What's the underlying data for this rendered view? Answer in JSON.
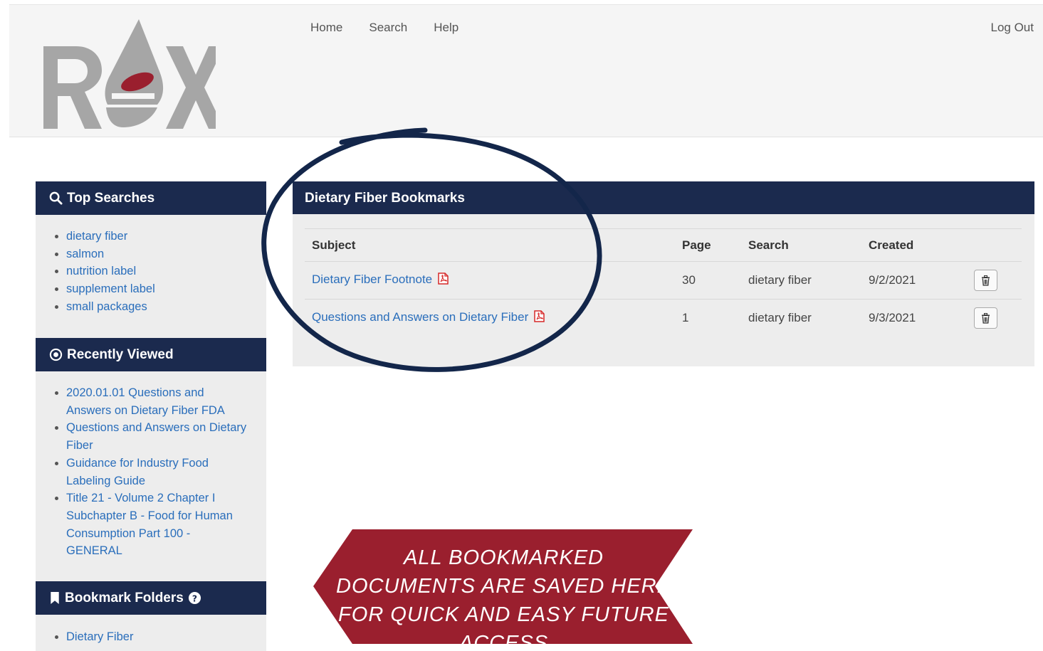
{
  "header": {
    "logo_text": "REX",
    "nav": [
      "Home",
      "Search",
      "Help"
    ],
    "logout": "Log Out"
  },
  "sidebar": {
    "top_searches": {
      "title": "Top Searches",
      "icon": "search-icon",
      "items": [
        "dietary fiber",
        "salmon",
        "nutrition label",
        "supplement label",
        "small packages"
      ]
    },
    "recently_viewed": {
      "title": "Recently Viewed",
      "icon": "eye-circle-icon",
      "items": [
        "2020.01.01 Questions and Answers on Dietary Fiber FDA",
        "Questions and Answers on Dietary Fiber",
        "Guidance for Industry Food Labeling Guide",
        "Title 21 - Volume 2 Chapter I Subchapter B - Food for Human Consumption Part 100 - GENERAL"
      ]
    },
    "bookmark_folders": {
      "title": "Bookmark Folders",
      "icon": "bookmark-icon",
      "help_icon": "question-circle-icon",
      "items": [
        "Dietary Fiber"
      ]
    }
  },
  "main": {
    "title": "Dietary Fiber Bookmarks",
    "columns": [
      "Subject",
      "Page",
      "Search",
      "Created",
      ""
    ],
    "rows": [
      {
        "subject": "Dietary Fiber Footnote",
        "page": "30",
        "search": "dietary fiber",
        "created": "9/2/2021"
      },
      {
        "subject": "Questions and Answers on Dietary Fiber",
        "page": "1",
        "search": "dietary fiber",
        "created": "9/3/2021"
      }
    ]
  },
  "callout": {
    "text": "ALL BOOKMARKED DOCUMENTS ARE SAVED HERE FOR QUICK AND EASY FUTURE ACCESS"
  },
  "colors": {
    "navy": "#1b2a4e",
    "link": "#2a6ebb",
    "banner": "#9a1f2e",
    "logo_gray": "#a6a6a6",
    "logo_red": "#9a1f2e"
  }
}
